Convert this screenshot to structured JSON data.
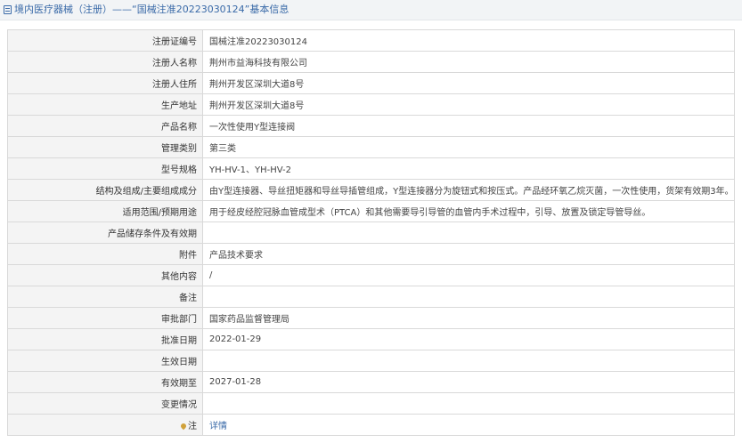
{
  "header": {
    "title": "境内医疗器械（注册）——“国械注准20223030124”基本信息"
  },
  "rows": [
    {
      "label": "注册证编号",
      "value": "国械注准20223030124"
    },
    {
      "label": "注册人名称",
      "value": "荆州市益海科技有限公司"
    },
    {
      "label": "注册人住所",
      "value": "荆州开发区深圳大道8号"
    },
    {
      "label": "生产地址",
      "value": "荆州开发区深圳大道8号"
    },
    {
      "label": "产品名称",
      "value": "一次性使用Y型连接阀"
    },
    {
      "label": "管理类别",
      "value": "第三类"
    },
    {
      "label": "型号规格",
      "value": "YH-HV-1、YH-HV-2"
    },
    {
      "label": "结构及组成/主要组成成分",
      "value": "由Y型连接器、导丝扭矩器和导丝导插管组成，Y型连接器分为旋钮式和按压式。产品经环氧乙烷灭菌，一次性使用，货架有效期3年。"
    },
    {
      "label": "适用范围/预期用途",
      "value": "用于经皮经腔冠脉血管成型术（PTCA）和其他需要导引导管的血管内手术过程中，引导、放置及锁定导管导丝。"
    },
    {
      "label": "产品储存条件及有效期",
      "value": ""
    },
    {
      "label": "附件",
      "value": "产品技术要求"
    },
    {
      "label": "其他内容",
      "value": "/"
    },
    {
      "label": "备注",
      "value": ""
    },
    {
      "label": "审批部门",
      "value": "国家药品监督管理局"
    },
    {
      "label": "批准日期",
      "value": "2022-01-29"
    },
    {
      "label": "生效日期",
      "value": ""
    },
    {
      "label": "有效期至",
      "value": "2027-01-28"
    },
    {
      "label": "变更情况",
      "value": ""
    }
  ],
  "note_row": {
    "label": "注",
    "value": "详情"
  }
}
